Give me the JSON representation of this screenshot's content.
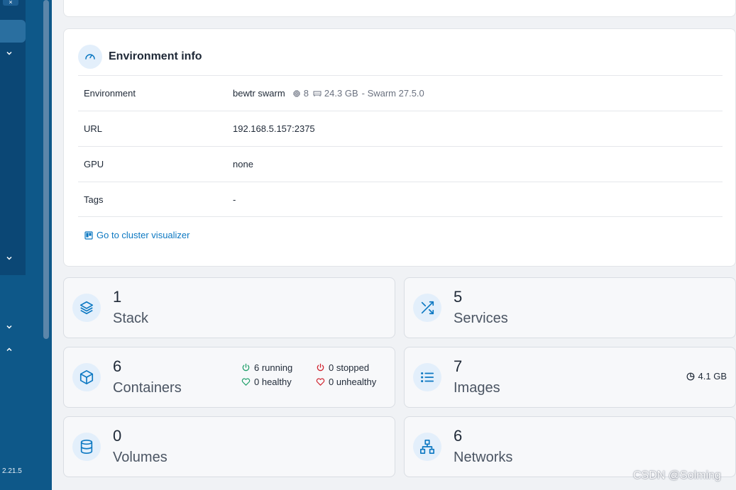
{
  "sidebar": {
    "close_label": "×",
    "version": "2.21.5"
  },
  "env_info": {
    "title": "Environment info",
    "rows": [
      {
        "label": "Environment",
        "value": "bewtr swarm",
        "cpu": "8",
        "memory": "24.3 GB",
        "platform": "- Swarm 27.5.0"
      },
      {
        "label": "URL",
        "value": "192.168.5.157:2375"
      },
      {
        "label": "GPU",
        "value": "none"
      },
      {
        "label": "Tags",
        "value": "-"
      }
    ],
    "visualizer_link": "Go to cluster visualizer"
  },
  "tiles": {
    "stack": {
      "count": "1",
      "label": "Stack"
    },
    "services": {
      "count": "5",
      "label": "Services"
    },
    "containers": {
      "count": "6",
      "label": "Containers",
      "running": "6 running",
      "stopped": "0 stopped",
      "healthy": "0 healthy",
      "unhealthy": "0 unhealthy"
    },
    "images": {
      "count": "7",
      "label": "Images",
      "size": "4.1 GB"
    },
    "volumes": {
      "count": "0",
      "label": "Volumes"
    },
    "networks": {
      "count": "6",
      "label": "Networks"
    }
  },
  "watermark": "CSDN @Solming",
  "colors": {
    "sidebar": "#0e5889",
    "accent": "#0c78c2",
    "running": "#22a06b",
    "stopped": "#d1242f"
  }
}
